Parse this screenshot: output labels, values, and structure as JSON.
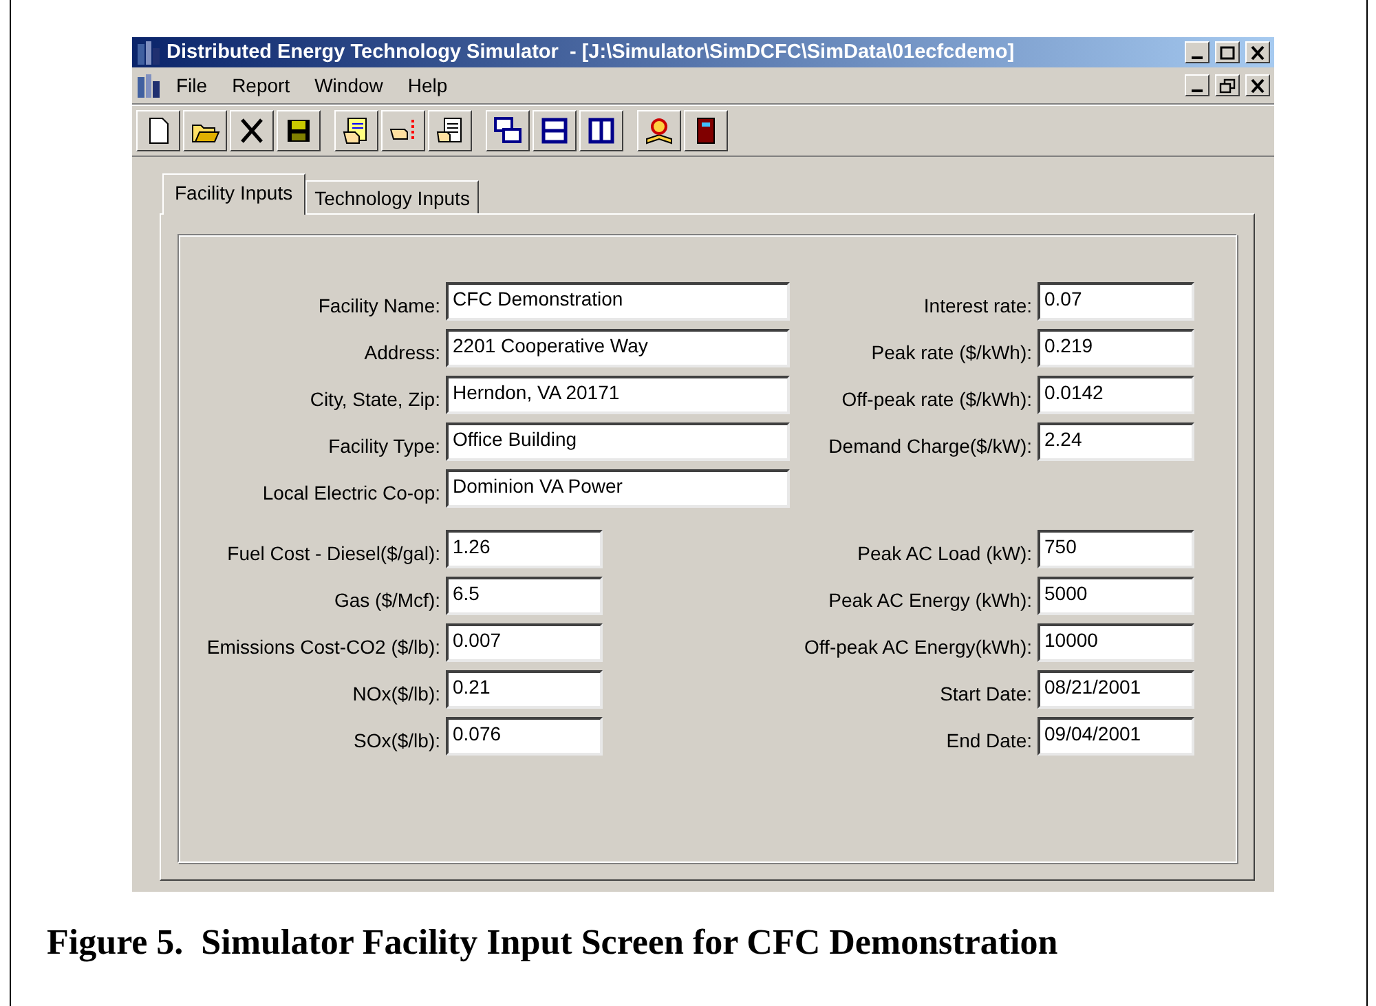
{
  "window": {
    "title": "Distributed Energy Technology Simulator  - [J:\\Simulator\\SimDCFC\\SimData\\01ecfcdemo]"
  },
  "menu": [
    "File",
    "Report",
    "Window",
    "Help"
  ],
  "toolbar": [
    [
      {
        "kind": "new"
      },
      {
        "kind": "open"
      },
      {
        "kind": "delete"
      },
      {
        "kind": "save"
      }
    ],
    [
      {
        "kind": "run"
      },
      {
        "kind": "point"
      },
      {
        "kind": "report"
      }
    ],
    [
      {
        "kind": "cascade"
      },
      {
        "kind": "tile_h"
      },
      {
        "kind": "tile_v"
      }
    ],
    [
      {
        "kind": "help"
      },
      {
        "kind": "exit"
      }
    ]
  ],
  "tabs": [
    {
      "label": "Facility Inputs",
      "selected": true
    },
    {
      "label": "Technology Inputs",
      "selected": false
    }
  ],
  "sections": [
    {
      "left": [
        {
          "label": "Facility Name:",
          "value": "CFC Demonstration"
        },
        {
          "label": "Address:",
          "value": "2201 Cooperative Way"
        },
        {
          "label": "City, State, Zip:",
          "value": "Herndon, VA 20171"
        },
        {
          "label": "Facility Type:",
          "value": "Office Building"
        },
        {
          "label": "Local Electric Co-op:",
          "value": "Dominion VA Power"
        }
      ],
      "right": [
        {
          "label": "Interest rate:",
          "value": "0.07"
        },
        {
          "label": "Peak rate ($/kWh):",
          "value": "0.219"
        },
        {
          "label": "Off-peak rate ($/kWh):",
          "value": "0.0142"
        },
        {
          "label": "Demand Charge($/kW):",
          "value": "2.24"
        }
      ]
    },
    {
      "left": [
        {
          "label": "Fuel Cost - Diesel($/gal):",
          "value": "1.26"
        },
        {
          "label": "Gas ($/Mcf):",
          "value": "6.5"
        },
        {
          "label": "Emissions Cost-CO2 ($/lb):",
          "value": "0.007"
        },
        {
          "label": "NOx($/lb):",
          "value": "0.21"
        },
        {
          "label": "SOx($/lb):",
          "value": "0.076"
        }
      ],
      "right": [
        {
          "label": "Peak AC Load (kW):",
          "value": "750"
        },
        {
          "label": "Peak AC Energy (kWh):",
          "value": "5000"
        },
        {
          "label": "Off-peak AC Energy(kWh):",
          "value": "10000"
        },
        {
          "label": "Start Date:",
          "value": "08/21/2001"
        },
        {
          "label": "End Date:",
          "value": "09/04/2001"
        }
      ]
    }
  ],
  "caption": "Figure 5.  Simulator Facility Input Screen for CFC Demonstration"
}
